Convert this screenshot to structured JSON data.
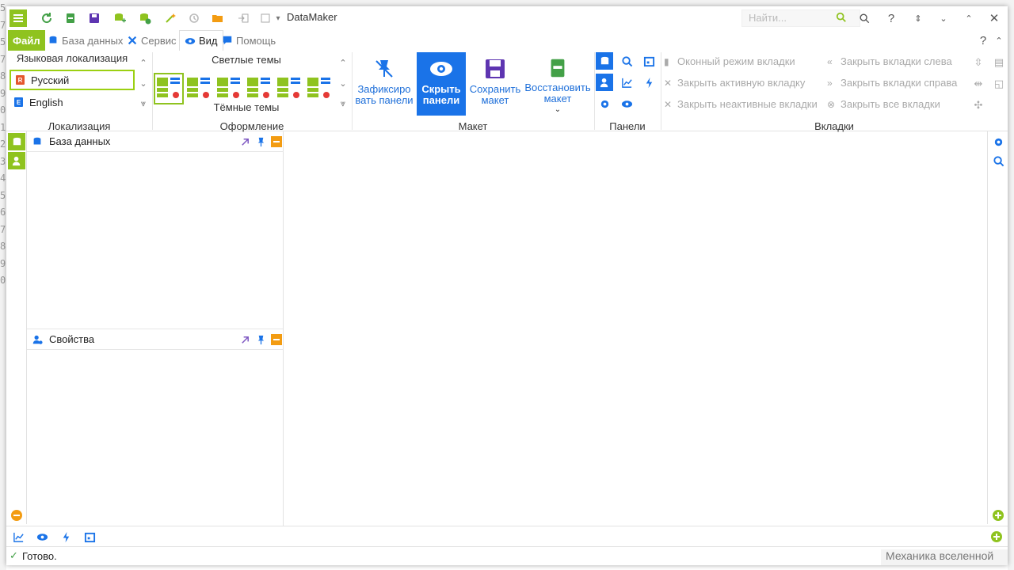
{
  "app": {
    "title": "DataMaker"
  },
  "search": {
    "placeholder": "Найти..."
  },
  "background": {
    "line_numbers": [
      "5",
      "7",
      "5",
      "7",
      "8",
      "9",
      "0",
      "1",
      "2",
      "3",
      "4",
      "5",
      "6",
      "7",
      "8",
      "9",
      "0"
    ]
  },
  "menu": {
    "file": "Файл",
    "database": "База данных",
    "service": "Сервис",
    "view": "Вид",
    "help": "Помощь"
  },
  "ribbon": {
    "localization": {
      "header": "Языковая локализация",
      "items": [
        {
          "label": "Русский",
          "flag": "R",
          "flag_color": "#e4572e",
          "selected": true
        },
        {
          "label": "English",
          "flag": "E",
          "flag_color": "#1a73e8",
          "selected": false
        }
      ],
      "group_label": "Локализация"
    },
    "design": {
      "light_themes": "Светлые темы",
      "dark_themes": "Тёмные темы",
      "group_label": "Оформление"
    },
    "layout": {
      "fix_panels": "Зафиксиро вать панели",
      "hide_panels": "Скрыть панели",
      "save_layout": "Сохранить макет",
      "restore_layout": "Восстановить макет",
      "group_label": "Макет"
    },
    "panels": {
      "group_label": "Панели"
    },
    "tabs": {
      "window_mode": "Оконный режим вкладки",
      "close_active": "Закрыть активную вкладку",
      "close_inactive": "Закрыть неактивные вкладки",
      "close_left": "Закрыть вкладки слева",
      "close_right": "Закрыть вкладки справа",
      "close_all": "Закрыть все вкладки",
      "group_label": "Вкладки"
    }
  },
  "panels": {
    "database": {
      "title": "База данных"
    },
    "properties": {
      "title": "Свойства"
    }
  },
  "status": {
    "text": "Готово.",
    "right_text": "Механика вселенной"
  },
  "colors": {
    "accent_green": "#8fc31f",
    "accent_blue": "#1a73e8",
    "accent_orange": "#f39c12"
  }
}
